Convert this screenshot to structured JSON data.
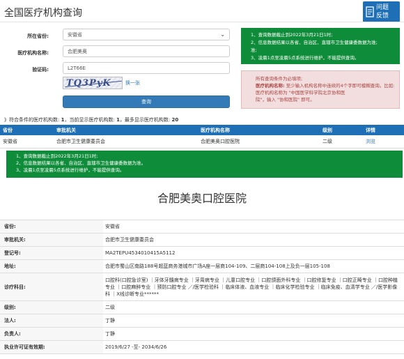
{
  "header": {
    "title": "全国医疗机构查询",
    "feedback_line1": "问题",
    "feedback_line2": "反馈"
  },
  "form": {
    "province_label": "所在省份:",
    "province_value": "安徽省",
    "org_name_label": "医疗机构名称:",
    "org_name_value": "合肥美奥",
    "captcha_label": "验证码:",
    "captcha_value": "L2T66E",
    "captcha_image_text": "TQ3PyK",
    "captcha_refresh": "换一张",
    "search_button": "查询"
  },
  "notice_top": {
    "line1": "1、查询数据截止到2022年3月21日1时;",
    "line2": "2、信息数据结果以各省、自治区、直辖市卫生健康委数据为准;",
    "line2b": "准;",
    "line3": "3、凌晨1点至凌晨5点系统进行维护，不能提供查询。"
  },
  "notice_required": {
    "line1": "所有查询条件为必填项;",
    "line2_label": "医疗机构名称:",
    "line2": " 至少输入机构名称中连续的4个字即可模糊查询。比如: 医疗机构名称为 \"中国医学科学院北京协和医",
    "line3": "院\"，输入 \"协和医院\" 即可。"
  },
  "summary": {
    "prefix": "》符合条件的医疗机构数:",
    "total": "1",
    "current_label": "，当前显示医疗机构数:",
    "current": "1",
    "max_label": "，最多显示医疗机构数:",
    "max": "20"
  },
  "results": {
    "headers": [
      "省份",
      "审批机关",
      "医疗机构名称",
      "级别",
      "详情"
    ],
    "rows": [
      [
        "安徽省",
        "合肥市卫生健康委员会",
        "合肥美奥口腔医院",
        "二级",
        "浏览"
      ]
    ]
  },
  "notice_bottom": {
    "line1": "1、查询数据截止到2022年3月21日1时;",
    "line2": "2、信息数据结果以各省、自治区、直辖市卫生健康委数据为准。",
    "line3": "3、凌晨1点至凌晨5点系统进行维护，不能提供查询。"
  },
  "detail": {
    "title": "合肥美奥口腔医院",
    "rows": [
      {
        "label": "省份:",
        "value": "安徽省"
      },
      {
        "label": "审批机关:",
        "value": "合肥市卫生健康委员会"
      },
      {
        "label": "登记号:",
        "value": "MA2TEPU4534010415A5112"
      },
      {
        "label": "地址:",
        "value": "合肥市蜀山区南路188号超蓝商务港城市广场A座一层商104-109、二层商104-108上及负一层105-108"
      },
      {
        "label": "诊疗科目:",
        "value": "口腔科(口腔急诊室) ｜牙体牙髓病专业 ｜牙周病专业 ｜儿童口腔专业 ｜口腔颌面外科专业 ｜口腔修复专业 ｜口腔正畸专业 ｜口腔种植专业 ｜口腔麻醉专业 ｜预防口腔专业 ／/医学检验科 ｜临床体液、血液专业 ｜临床化学检验专业 ｜临床免疫、血清学专业 ／/医学影像科 ｜X线诊断专业******"
      },
      {
        "label": "级别:",
        "value": "二级"
      },
      {
        "label": "法人:",
        "value": "丁静"
      },
      {
        "label": "负责人:",
        "value": "丁静"
      },
      {
        "label": "执业许可证有效期:",
        "value": "2019/6/27 -至- 2034/6/26"
      }
    ]
  }
}
